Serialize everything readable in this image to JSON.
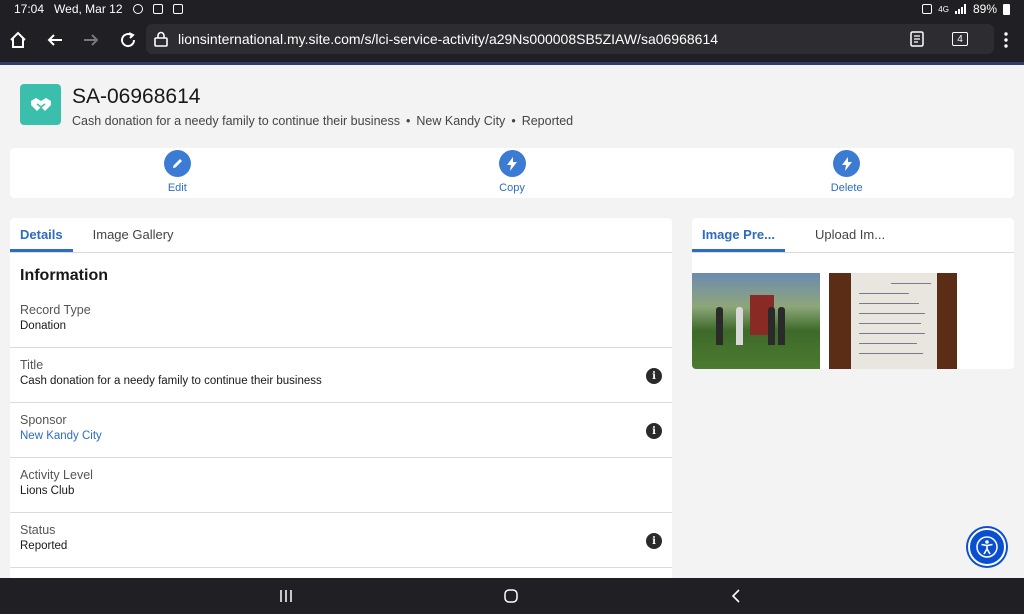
{
  "status_bar": {
    "time": "17:04",
    "date": "Wed, Mar 12",
    "battery": "89%",
    "network": "4G"
  },
  "browser": {
    "url": "lionsinternational.my.site.com/s/lci-service-activity/a29Ns000008SB5ZIAW/sa06968614",
    "tab_count": "4"
  },
  "record": {
    "title": "SA-06968614",
    "subtitle_parts": [
      "Cash donation for a needy family to continue their business",
      "New Kandy City",
      "Reported"
    ]
  },
  "actions": [
    {
      "label": "Edit",
      "icon": "pencil-icon"
    },
    {
      "label": "Copy",
      "icon": "lightning-icon"
    },
    {
      "label": "Delete",
      "icon": "lightning-icon"
    }
  ],
  "left_tabs": [
    "Details",
    "Image Gallery"
  ],
  "section_title": "Information",
  "fields": [
    {
      "label": "Record Type",
      "value": "Donation",
      "info": false,
      "link": false
    },
    {
      "label": "Title",
      "value": "Cash donation for a needy family to continue their business",
      "info": true,
      "link": false
    },
    {
      "label": "Sponsor",
      "value": "New Kandy City",
      "info": true,
      "link": true
    },
    {
      "label": "Activity Level",
      "value": "Lions Club",
      "info": false,
      "link": false
    },
    {
      "label": "Status",
      "value": "Reported",
      "info": true,
      "link": false
    }
  ],
  "right_tabs": [
    "Image Pre...",
    "Upload Im..."
  ],
  "colors": {
    "accent": "#2d6cc0",
    "record_icon_bg": "#3bbfad",
    "action_circle": "#3b7bd4",
    "a11y": "#0b4fd1"
  }
}
